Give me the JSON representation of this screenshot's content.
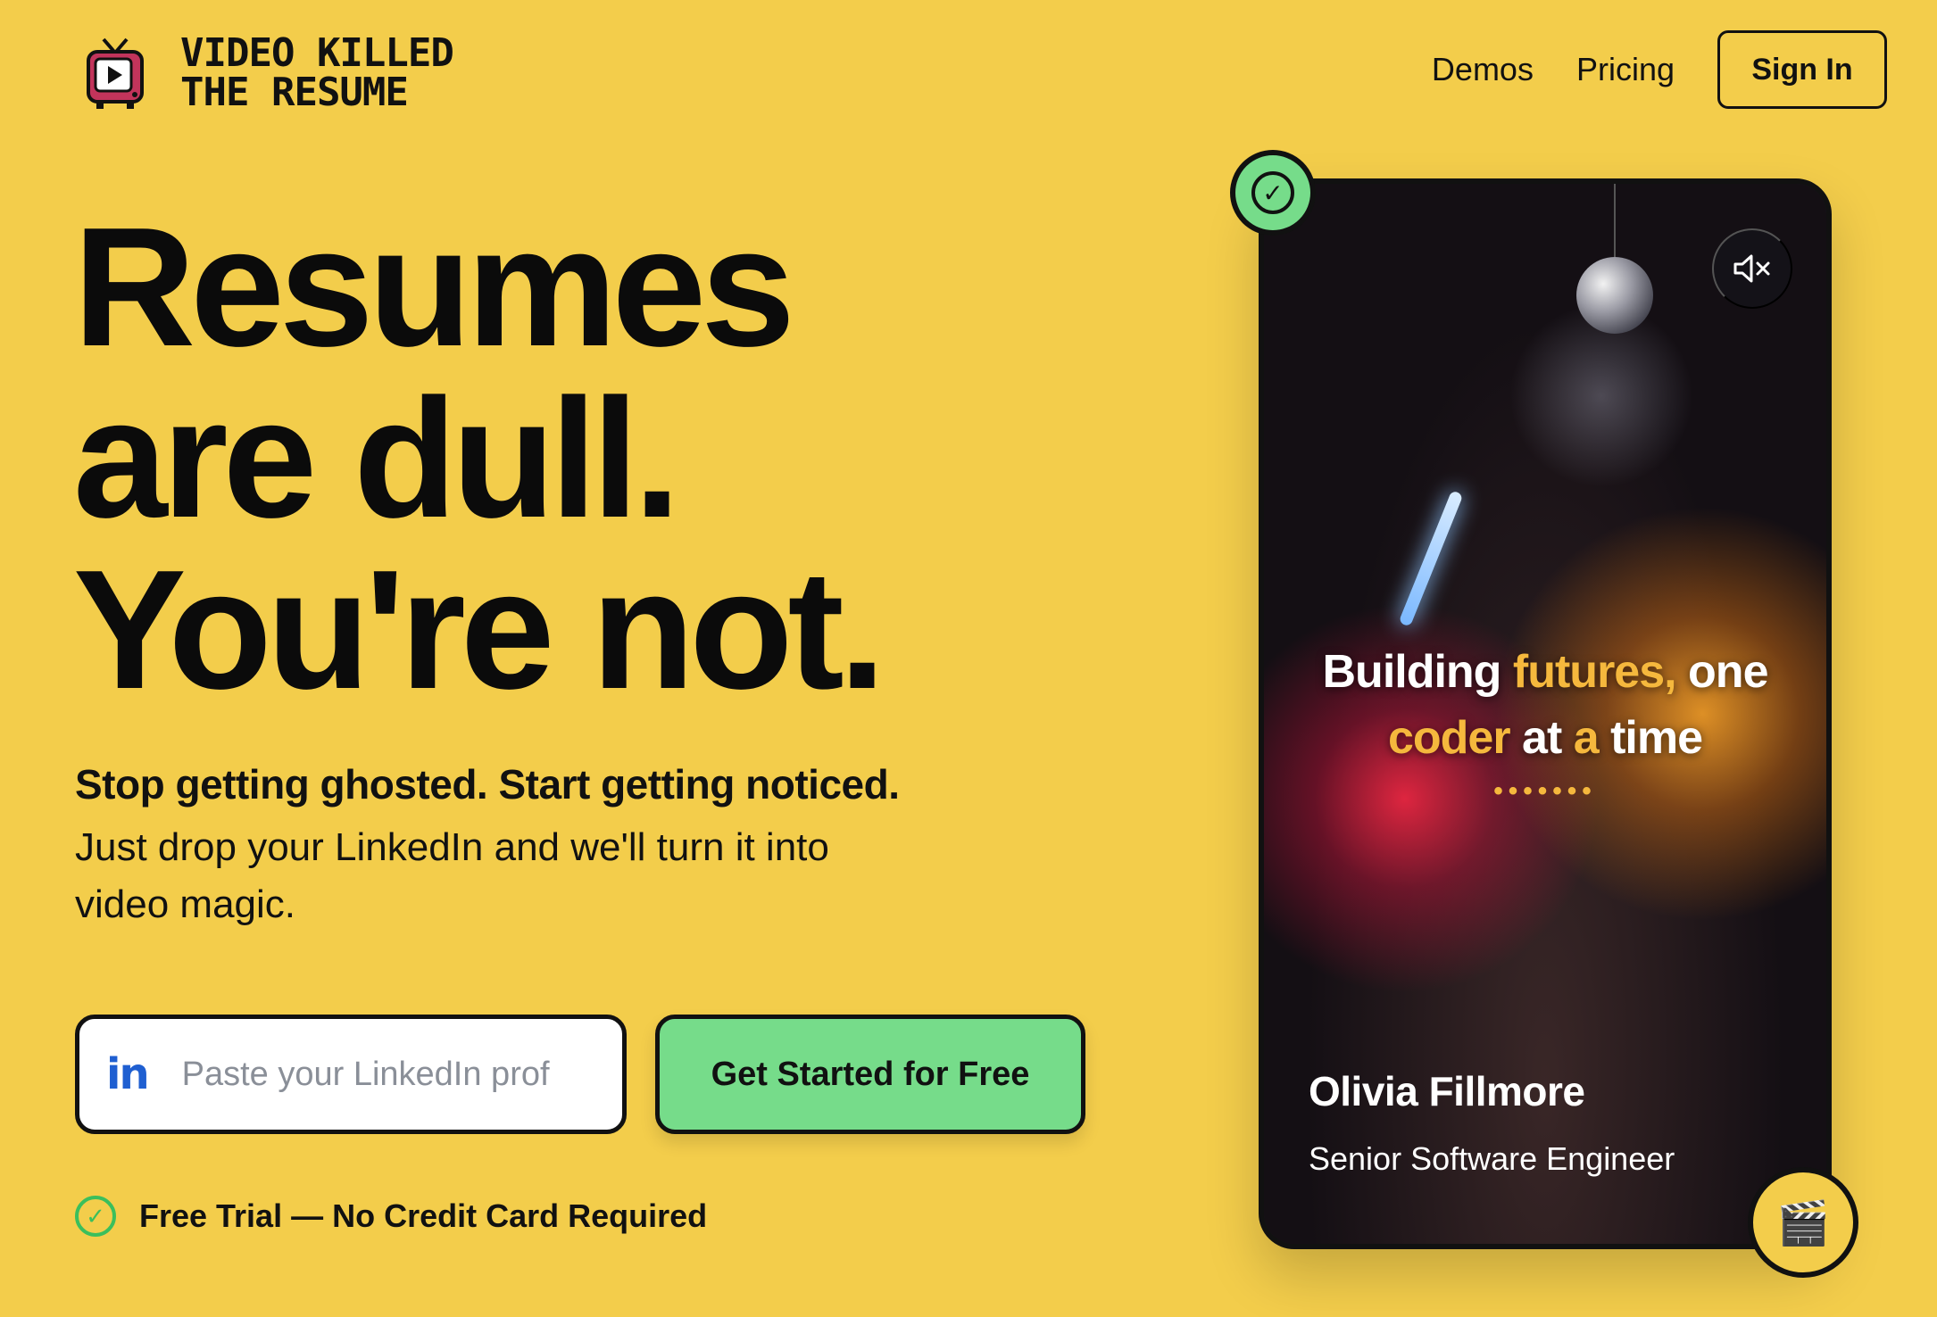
{
  "header": {
    "logo_line1": "VIDEO KILLED",
    "logo_line2": "THE RESUME",
    "nav": {
      "demos": "Demos",
      "pricing": "Pricing",
      "sign_in": "Sign In"
    }
  },
  "hero": {
    "headline_line1": "Resumes",
    "headline_line2": "are dull.",
    "headline_line3": "You're not.",
    "sub_strong": "Stop getting ghosted. Start getting noticed.",
    "sub_body": "Just drop your LinkedIn and we'll turn it into video magic.",
    "linkedin_icon_text": "in",
    "linkedin_placeholder": "Paste your LinkedIn prof",
    "cta_label": "Get Started for Free",
    "trial_text": "Free Trial — No Credit Card Required"
  },
  "video_card": {
    "caption_part1": "Building ",
    "caption_hl1": "futures,",
    "caption_part2": " one",
    "caption_hl2": "coder",
    "caption_part3": " at ",
    "caption_hl3": "a",
    "caption_part4": " time",
    "dots": "•••••••",
    "person_name": "Olivia Fillmore",
    "person_title": "Senior Software Engineer",
    "mute_icon": "🔇",
    "verified_icon": "✓",
    "clapper_icon": "🎬"
  },
  "colors": {
    "background": "#f3cd4b",
    "accent_green": "#76dc8a",
    "caption_highlight": "#f5b83d",
    "linkedin_blue": "#1f5fd1"
  }
}
